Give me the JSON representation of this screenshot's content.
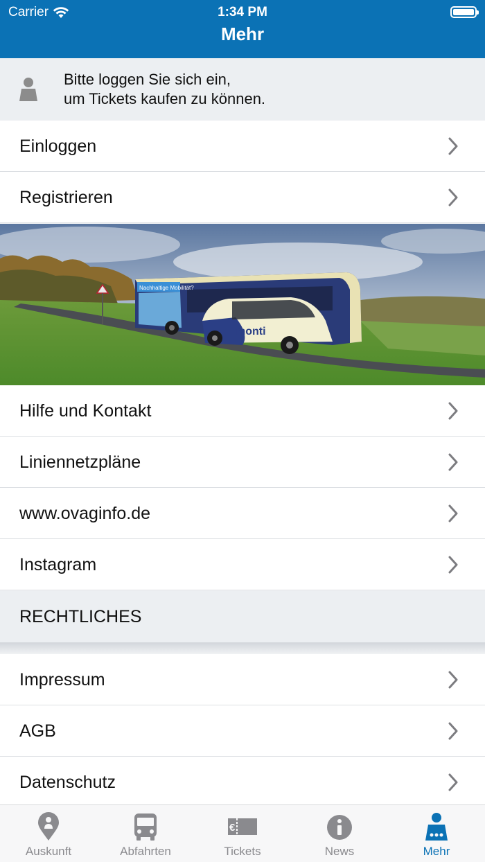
{
  "status_bar": {
    "carrier": "Carrier",
    "time": "1:34 PM"
  },
  "nav": {
    "title": "Mehr"
  },
  "login_prompt": {
    "line1": "Bitte loggen Sie sich ein,",
    "line2": "um Tickets kaufen zu können."
  },
  "account_rows": [
    {
      "label": "Einloggen"
    },
    {
      "label": "Registrieren"
    }
  ],
  "info_rows": [
    {
      "label": "Hilfe und Kontakt"
    },
    {
      "label": "Liniennetzpläne"
    },
    {
      "label": "www.ovaginfo.de"
    },
    {
      "label": "Instagram"
    }
  ],
  "legal_section": {
    "title": "RECHTLICHES"
  },
  "legal_rows": [
    {
      "label": "Impressum"
    },
    {
      "label": "AGB"
    },
    {
      "label": "Datenschutz"
    }
  ],
  "banner": {
    "bus_sign": "Nachhaltige Mobilität?",
    "taxi_brand": "monti"
  },
  "tabs": [
    {
      "label": "Auskunft",
      "icon": "location-pin-icon"
    },
    {
      "label": "Abfahrten",
      "icon": "bus-icon"
    },
    {
      "label": "Tickets",
      "icon": "ticket-icon"
    },
    {
      "label": "News",
      "icon": "info-icon"
    },
    {
      "label": "Mehr",
      "icon": "person-icon",
      "active": true
    }
  ],
  "colors": {
    "accent": "#0b72b5",
    "inactive": "#8a8a8e",
    "background": "#f0f2f4"
  }
}
